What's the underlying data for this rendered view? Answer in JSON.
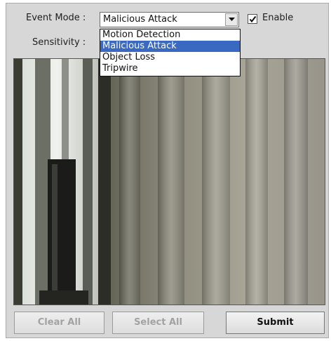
{
  "event_mode": {
    "label": "Event Mode :",
    "selected": "Malicious Attack",
    "options": [
      "Motion Detection",
      "Malicious Attack",
      "Object Loss",
      "Tripwire"
    ],
    "selected_index": 1
  },
  "enable": {
    "label": "Enable",
    "checked": true
  },
  "sensitivity": {
    "label": "Sensitivity :"
  },
  "buttons": {
    "clear_all": "Clear All",
    "select_all": "Select All",
    "submit": "Submit"
  },
  "colors": {
    "panel": "#d7d7d7",
    "highlight": "#3969c1",
    "disabled_text": "#a2a2a2"
  },
  "icons": {
    "dropdown": "chevron-down-icon",
    "check": "checkmark-icon"
  }
}
